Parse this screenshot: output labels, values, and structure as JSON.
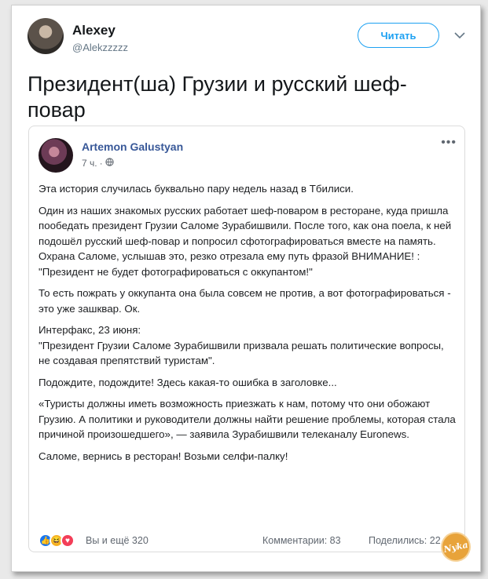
{
  "tweet": {
    "author_name": "Alexey",
    "author_handle": "@Alekzzzzz",
    "follow_label": "Читать",
    "text": "Президент(ша) Грузии и русский шеф-повар"
  },
  "embed": {
    "author": "Artemon Galustyan",
    "time": "7 ч.",
    "separator": "·",
    "more_icon": "more-dots-icon",
    "paragraphs": [
      "Эта история случилась буквально пару недель назад в Тбилиси.",
      "Один из наших знакомых русских работает шеф-поваром в ресторане, куда пришла пообедать президент Грузии Саломе Зурабишвили. После того, как она поела, к ней подошёл русский шеф-повар и попросил сфотографироваться вместе на память. Охрана Саломе, услышав это, резко отрезала ему путь фразой ВНИМАНИЕ! : \"Президент не будет фотографироваться с оккупантом!\"",
      "То есть пожрать у оккупанта она была совсем не против, а вот фотографироваться - это уже зашквар. Ок.",
      "Интерфакс, 23 июня:\n\"Президент Грузии Саломе Зурабишвили призвала решать политические вопросы, не создавая препятствий туристам\".",
      "Подождите, подождите! Здесь какая-то ошибка в заголовке...",
      "«Туристы должны иметь возможность приезжать к нам, потому что они обожают Грузию. А политики и руководители должны найти решение проблемы, которая стала причиной произошедшего», — заявила Зурабишвили телеканалу Euronews.",
      "Саломе, вернись в ресторан! Возьми селфи-палку!"
    ],
    "reactions_text": "Вы и ещё 320",
    "comments_text": "Комментарии: 83",
    "shares_text": "Поделились: 22"
  },
  "watermark": "Nyka",
  "colors": {
    "accent": "#1da1f2",
    "fb_link": "#385898"
  }
}
